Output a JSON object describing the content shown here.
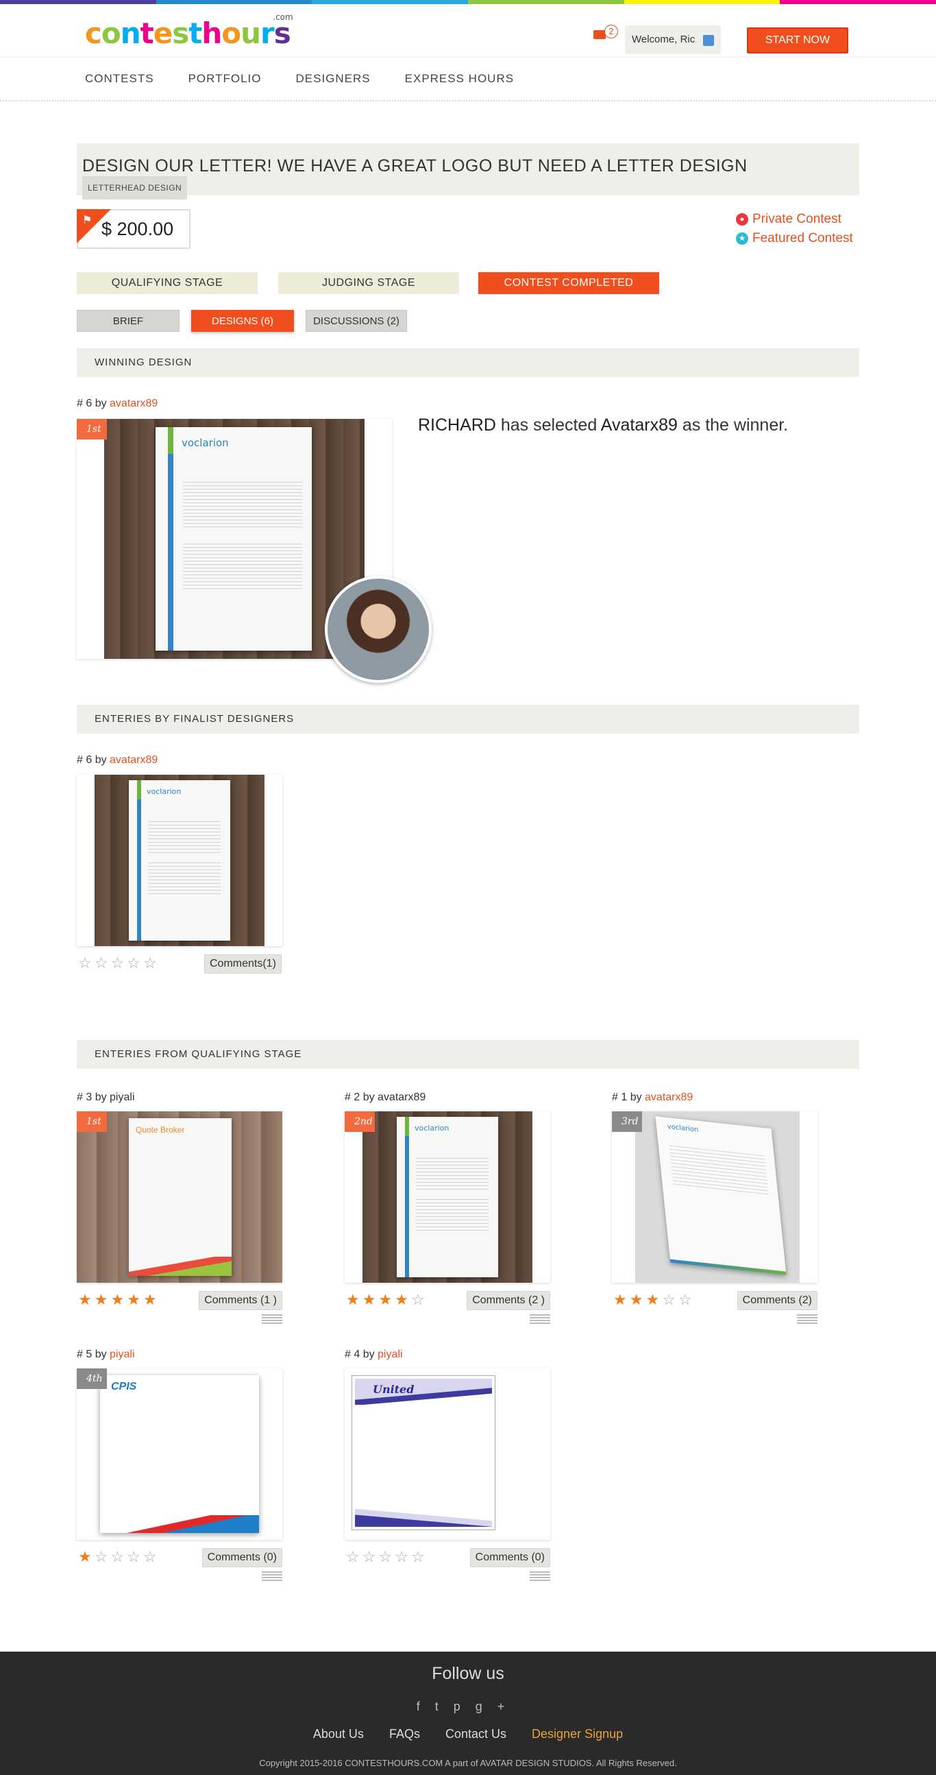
{
  "brand": {
    "name_parts": [
      {
        "t": "c",
        "c": "#f7941d"
      },
      {
        "t": "o",
        "c": "#8dc63f"
      },
      {
        "t": "n",
        "c": "#00aeef"
      },
      {
        "t": "t",
        "c": "#ec008c"
      },
      {
        "t": "e",
        "c": "#f7941d"
      },
      {
        "t": "s",
        "c": "#8dc63f"
      },
      {
        "t": "t",
        "c": "#00aeef"
      },
      {
        "t": "h",
        "c": "#ec008c"
      },
      {
        "t": "o",
        "c": "#f7941d"
      },
      {
        "t": "u",
        "c": "#8dc63f"
      },
      {
        "t": "r",
        "c": "#00aeef"
      },
      {
        "t": "s",
        "c": "#662d91"
      }
    ],
    "suffix": ".com"
  },
  "header": {
    "mail_count": "2",
    "welcome": "Welcome, Ric",
    "start_button": "START NOW"
  },
  "nav": [
    "CONTESTS",
    "PORTFOLIO",
    "DESIGNERS",
    "EXPRESS HOURS"
  ],
  "contest": {
    "title": "DESIGN OUR LETTER! WE HAVE A GREAT LOGO BUT NEED A LETTER DESIGN",
    "tag": "LETTERHEAD DESIGN",
    "prize": "$ 200.00",
    "private_label": "Private Contest",
    "featured_label": "Featured Contest"
  },
  "stages": [
    "QUALIFYING STAGE",
    "JUDGING STAGE",
    "CONTEST COMPLETED"
  ],
  "tabs": [
    "BRIEF",
    "DESIGNS (6)",
    "DISCUSSIONS (2)"
  ],
  "winning": {
    "section": "WINNING DESIGN",
    "entry_prefix": "# 6 by ",
    "author": "avatarx89",
    "rank": "1st",
    "brand_text": "voclarion",
    "msg_client": "RICHARD",
    "msg_mid": " has selected ",
    "msg_winner": "Avatarx89",
    "msg_end": " as the winner."
  },
  "finalists": {
    "section": "ENTERIES BY FINALIST DESIGNERS",
    "entry_prefix": "# 6 by ",
    "author": "avatarx89",
    "brand_text": "voclarion",
    "comments": "Comments(1)",
    "rating": 0
  },
  "qualifying": {
    "section": "ENTERIES FROM QUALIFYING STAGE",
    "entries": [
      {
        "prefix": "# 3 by ",
        "author": "piyali",
        "author_link": false,
        "rank": "1st",
        "rank_color": "#f26a3d",
        "rating": 5,
        "comments": "Comments (1 )",
        "brand": "Quote Broker"
      },
      {
        "prefix": "# 2 by ",
        "author": "avatarx89",
        "author_link": false,
        "rank": "2nd",
        "rank_color": "#f26a3d",
        "rating": 4,
        "comments": "Comments (2 )",
        "brand": "voclarion"
      },
      {
        "prefix": "# 1 by ",
        "author": "avatarx89",
        "author_link": true,
        "rank": "3rd",
        "rank_color": "#8a8a8a",
        "rating": 3,
        "comments": "Comments (2)",
        "brand": "voclarion"
      },
      {
        "prefix": "# 5 by ",
        "author": "piyali",
        "author_link": true,
        "rank": "4th",
        "rank_color": "#8a8a8a",
        "rating": 1,
        "comments": "Comments (0)",
        "brand": "CPIS"
      },
      {
        "prefix": "# 4 by ",
        "author": "piyali",
        "author_link": true,
        "rank": "",
        "rank_color": "",
        "rating": 0,
        "comments": "Comments (0)",
        "brand": "United"
      }
    ]
  },
  "footer": {
    "follow": "Follow us",
    "social_icons": [
      "facebook-icon",
      "twitter-icon",
      "pinterest-icon",
      "google-plus-icon"
    ],
    "social_glyphs": [
      "f",
      "t",
      "p",
      "g+"
    ],
    "links": [
      "About Us",
      "FAQs",
      "Contact Us",
      "Designer Signup"
    ],
    "copyright": "Copyright 2015-2016 CONTESTHOURS.COM A part of AVATAR DESIGN STUDIOS. All Rights Reserved."
  },
  "colors": {
    "accent": "#f04e1c",
    "rainbow": [
      "#4b3f9a",
      "#1f8bc8",
      "#27a9e1",
      "#8dc63f",
      "#fff200",
      "#ec008c"
    ]
  }
}
